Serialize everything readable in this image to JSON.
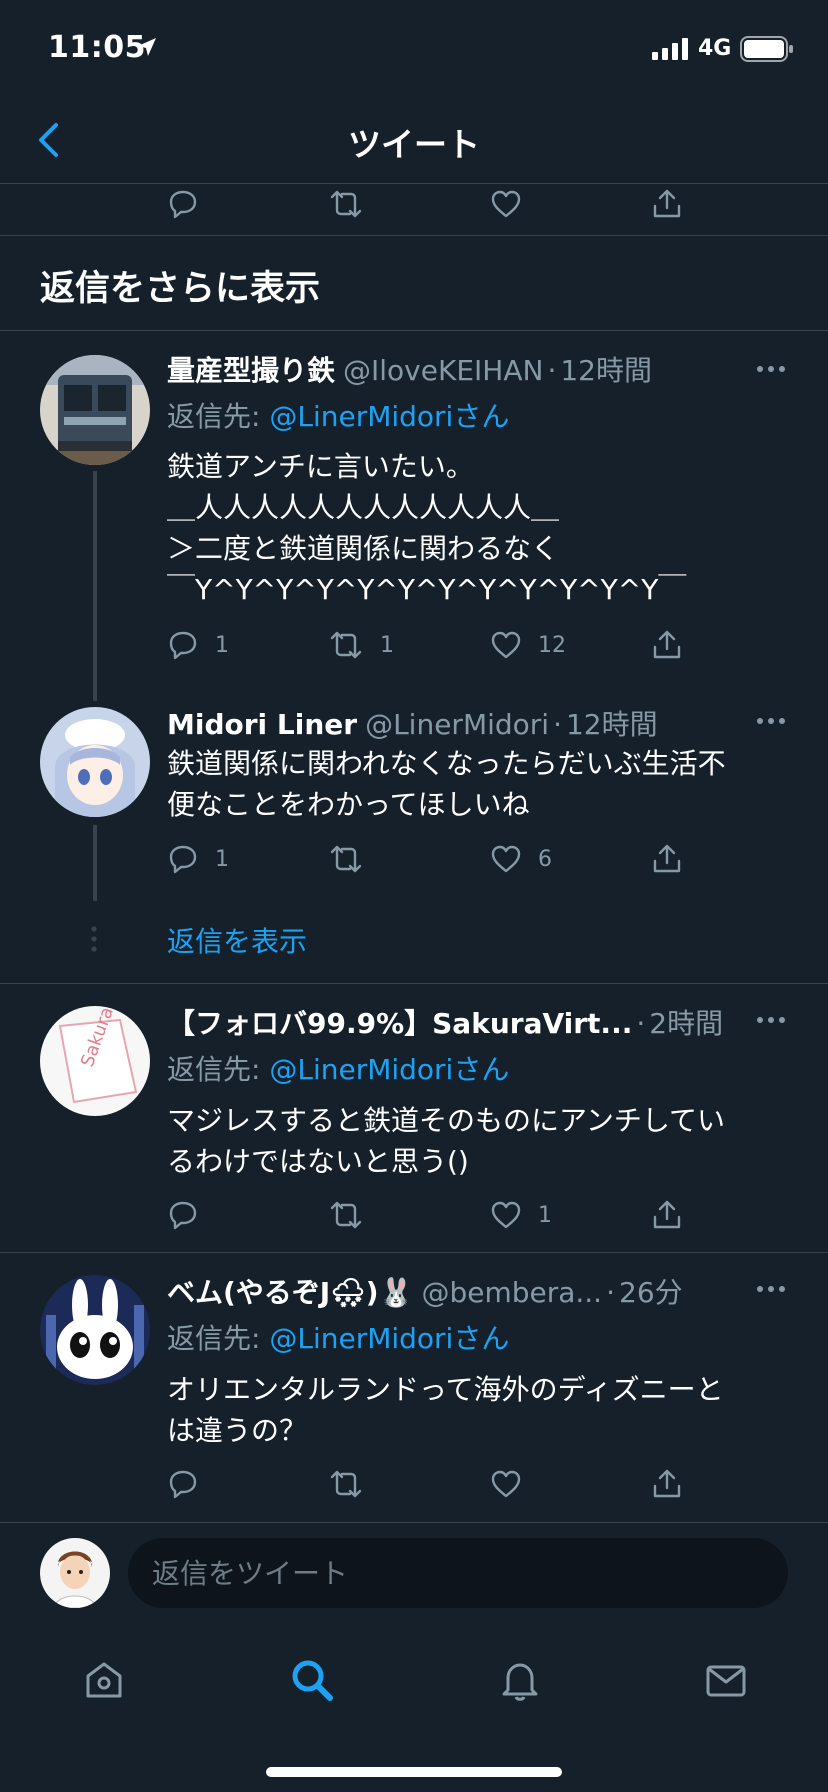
{
  "status": {
    "time": "11:05",
    "network": "4G"
  },
  "header": {
    "title": "ツイート"
  },
  "more_replies": {
    "label": "返信をさらに表示"
  },
  "colors": {
    "background": "#15202b",
    "accent": "#1da1f2",
    "muted": "#8899a6",
    "divider": "#38444d"
  },
  "tweets": [
    {
      "name": "量産型撮り鉄",
      "handle": "@IloveKEIHAN",
      "time": "12時間",
      "reply_prefix": "返信先: ",
      "reply_mention": "@LinerMidori",
      "reply_suffix": "さん",
      "lines": [
        "鉄道アンチに言いたい。",
        "＿人人人人人人人人人人人人＿",
        "＞二度と鉄道関係に関わるなく",
        "￣Y^Y^Y^Y^Y^Y^Y^Y^Y^Y^Y^Y￣"
      ],
      "replies": "1",
      "retweets": "1",
      "likes": "12"
    },
    {
      "name": "Midori Liner",
      "handle": "@LinerMidori",
      "time": "12時間",
      "lines": [
        "鉄道関係に関われなくなったらだいぶ生活不",
        "便なことをわかってほしいね"
      ],
      "replies": "1",
      "retweets": "",
      "likes": "6"
    },
    {
      "name": "【フォロバ99.9%】SakuraVirt...",
      "handle": "",
      "time": "2時間",
      "reply_prefix": "返信先: ",
      "reply_mention": "@LinerMidori",
      "reply_suffix": "さん",
      "lines": [
        "マジレスすると鉄道そのものにアンチしてい",
        "るわけではないと思う()"
      ],
      "replies": "",
      "retweets": "",
      "likes": "1"
    },
    {
      "name": "ベム(やるぞJ🌨)🐰",
      "handle": "@bembera...",
      "time": "26分",
      "reply_prefix": "返信先: ",
      "reply_mention": "@LinerMidori",
      "reply_suffix": "さん",
      "lines": [
        "オリエンタルランドって海外のディズニーと",
        "は違うの？"
      ],
      "replies": "",
      "retweets": "",
      "likes": ""
    }
  ],
  "show_replies": {
    "label": "返信を表示"
  },
  "avatar_text": {
    "sakura": "Sakura"
  },
  "compose": {
    "placeholder": "返信をツイート"
  },
  "tabs": [
    "home-icon",
    "search-icon",
    "bell-icon",
    "mail-icon"
  ]
}
